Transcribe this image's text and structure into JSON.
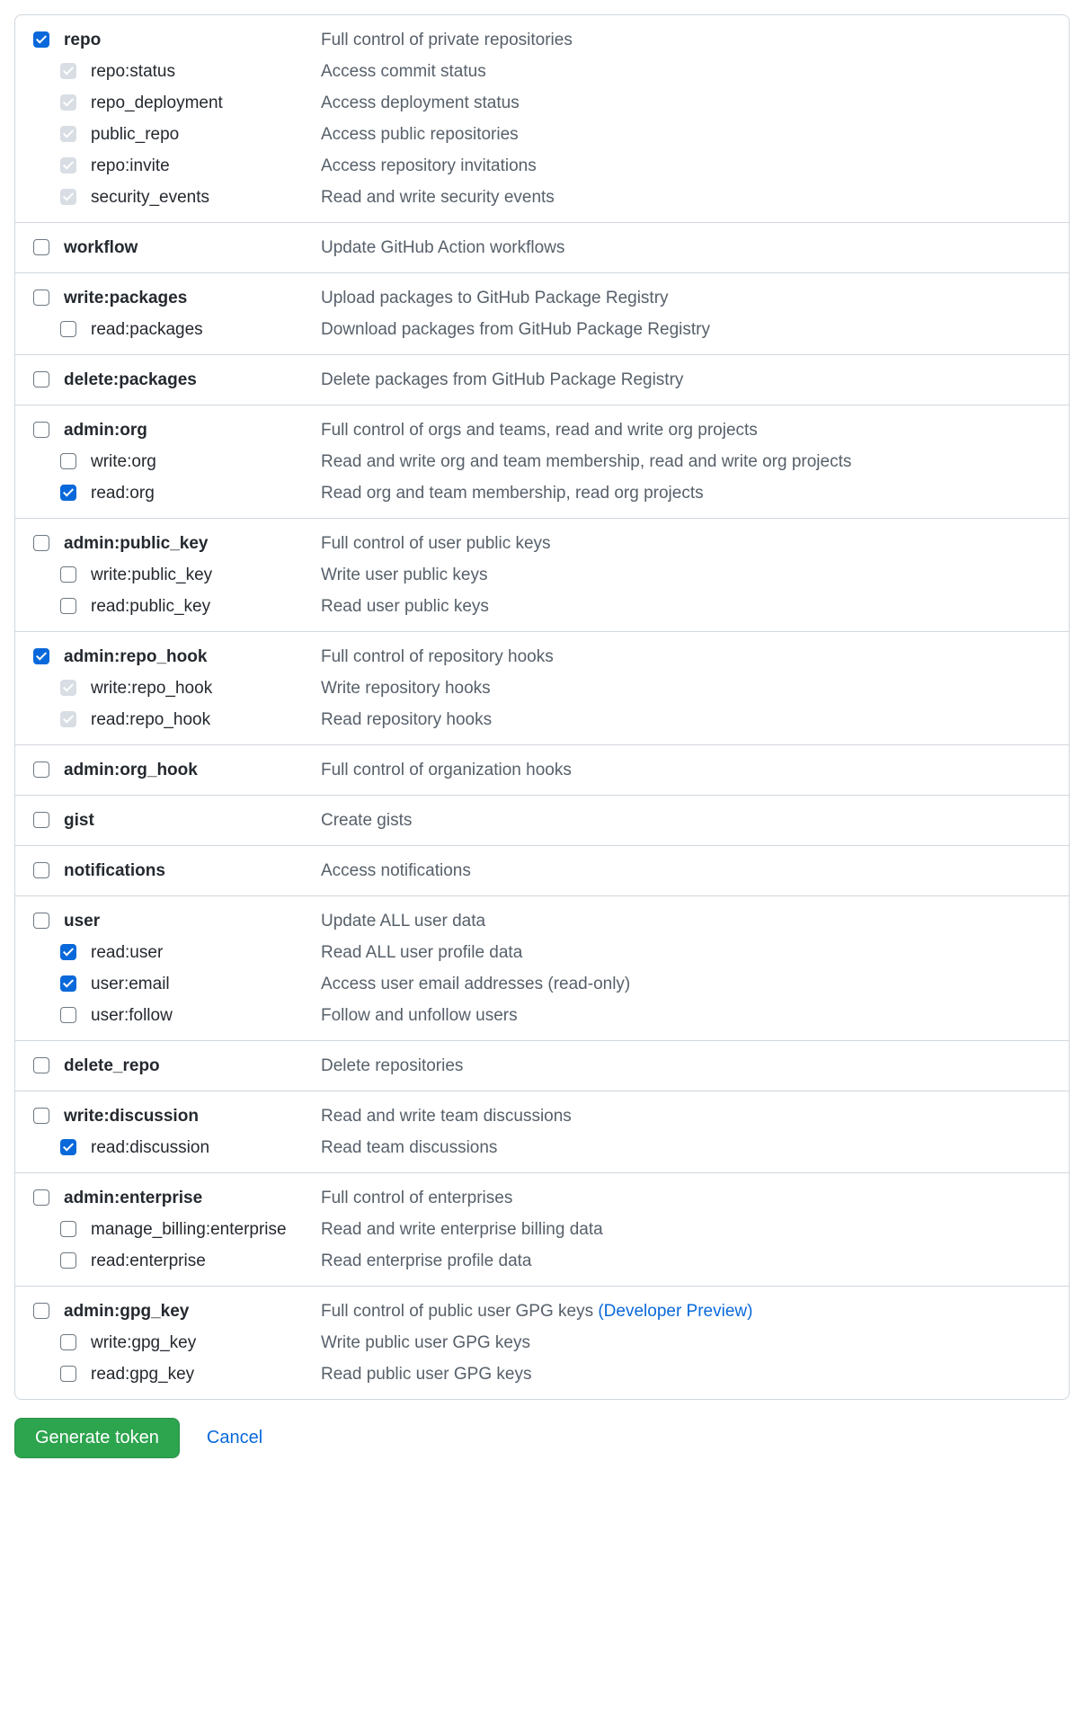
{
  "actions": {
    "generate": "Generate token",
    "cancel": "Cancel"
  },
  "groups": [
    {
      "parent": {
        "name": "repo",
        "desc": "Full control of private repositories",
        "checked": true,
        "disabled": false
      },
      "children": [
        {
          "name": "repo:status",
          "desc": "Access commit status",
          "checked": true,
          "disabled": true
        },
        {
          "name": "repo_deployment",
          "desc": "Access deployment status",
          "checked": true,
          "disabled": true
        },
        {
          "name": "public_repo",
          "desc": "Access public repositories",
          "checked": true,
          "disabled": true
        },
        {
          "name": "repo:invite",
          "desc": "Access repository invitations",
          "checked": true,
          "disabled": true
        },
        {
          "name": "security_events",
          "desc": "Read and write security events",
          "checked": true,
          "disabled": true
        }
      ]
    },
    {
      "parent": {
        "name": "workflow",
        "desc": "Update GitHub Action workflows",
        "checked": false,
        "disabled": false
      },
      "children": []
    },
    {
      "parent": {
        "name": "write:packages",
        "desc": "Upload packages to GitHub Package Registry",
        "checked": false,
        "disabled": false
      },
      "children": [
        {
          "name": "read:packages",
          "desc": "Download packages from GitHub Package Registry",
          "checked": false,
          "disabled": false
        }
      ]
    },
    {
      "parent": {
        "name": "delete:packages",
        "desc": "Delete packages from GitHub Package Registry",
        "checked": false,
        "disabled": false
      },
      "children": []
    },
    {
      "parent": {
        "name": "admin:org",
        "desc": "Full control of orgs and teams, read and write org projects",
        "checked": false,
        "disabled": false
      },
      "children": [
        {
          "name": "write:org",
          "desc": "Read and write org and team membership, read and write org projects",
          "checked": false,
          "disabled": false
        },
        {
          "name": "read:org",
          "desc": "Read org and team membership, read org projects",
          "checked": true,
          "disabled": false
        }
      ]
    },
    {
      "parent": {
        "name": "admin:public_key",
        "desc": "Full control of user public keys",
        "checked": false,
        "disabled": false
      },
      "children": [
        {
          "name": "write:public_key",
          "desc": "Write user public keys",
          "checked": false,
          "disabled": false
        },
        {
          "name": "read:public_key",
          "desc": "Read user public keys",
          "checked": false,
          "disabled": false
        }
      ]
    },
    {
      "parent": {
        "name": "admin:repo_hook",
        "desc": "Full control of repository hooks",
        "checked": true,
        "disabled": false
      },
      "children": [
        {
          "name": "write:repo_hook",
          "desc": "Write repository hooks",
          "checked": true,
          "disabled": true
        },
        {
          "name": "read:repo_hook",
          "desc": "Read repository hooks",
          "checked": true,
          "disabled": true
        }
      ]
    },
    {
      "parent": {
        "name": "admin:org_hook",
        "desc": "Full control of organization hooks",
        "checked": false,
        "disabled": false
      },
      "children": []
    },
    {
      "parent": {
        "name": "gist",
        "desc": "Create gists",
        "checked": false,
        "disabled": false
      },
      "children": []
    },
    {
      "parent": {
        "name": "notifications",
        "desc": "Access notifications",
        "checked": false,
        "disabled": false
      },
      "children": []
    },
    {
      "parent": {
        "name": "user",
        "desc": "Update ALL user data",
        "checked": false,
        "disabled": false
      },
      "children": [
        {
          "name": "read:user",
          "desc": "Read ALL user profile data",
          "checked": true,
          "disabled": false
        },
        {
          "name": "user:email",
          "desc": "Access user email addresses (read-only)",
          "checked": true,
          "disabled": false
        },
        {
          "name": "user:follow",
          "desc": "Follow and unfollow users",
          "checked": false,
          "disabled": false
        }
      ]
    },
    {
      "parent": {
        "name": "delete_repo",
        "desc": "Delete repositories",
        "checked": false,
        "disabled": false
      },
      "children": []
    },
    {
      "parent": {
        "name": "write:discussion",
        "desc": "Read and write team discussions",
        "checked": false,
        "disabled": false
      },
      "children": [
        {
          "name": "read:discussion",
          "desc": "Read team discussions",
          "checked": true,
          "disabled": false
        }
      ]
    },
    {
      "parent": {
        "name": "admin:enterprise",
        "desc": "Full control of enterprises",
        "checked": false,
        "disabled": false
      },
      "children": [
        {
          "name": "manage_billing:enterprise",
          "desc": "Read and write enterprise billing data",
          "checked": false,
          "disabled": false
        },
        {
          "name": "read:enterprise",
          "desc": "Read enterprise profile data",
          "checked": false,
          "disabled": false
        }
      ]
    },
    {
      "parent": {
        "name": "admin:gpg_key",
        "desc": "Full control of public user GPG keys ",
        "link": "(Developer Preview)",
        "checked": false,
        "disabled": false
      },
      "children": [
        {
          "name": "write:gpg_key",
          "desc": "Write public user GPG keys",
          "checked": false,
          "disabled": false
        },
        {
          "name": "read:gpg_key",
          "desc": "Read public user GPG keys",
          "checked": false,
          "disabled": false
        }
      ]
    }
  ]
}
